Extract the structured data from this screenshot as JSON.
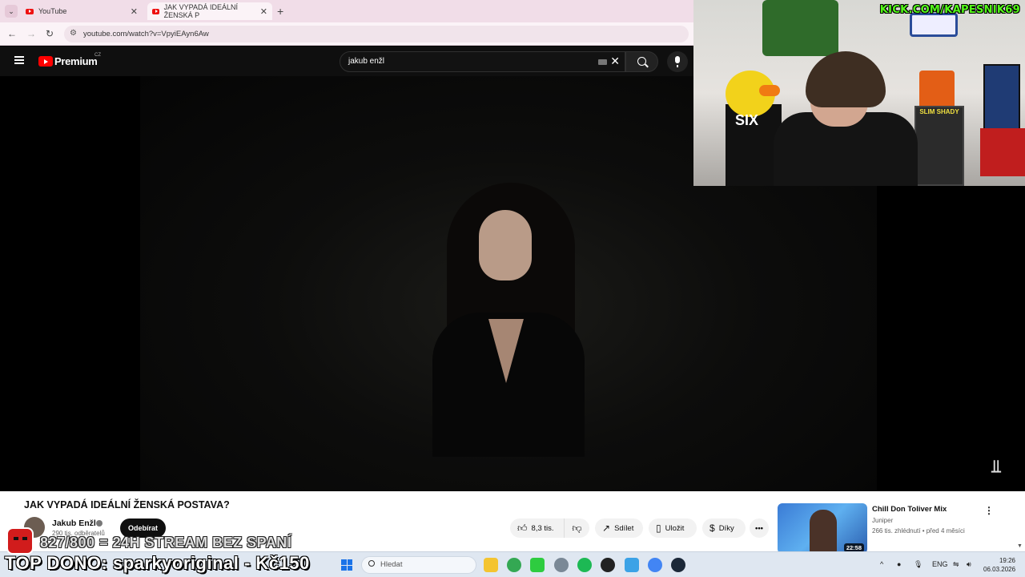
{
  "browser": {
    "tabs": [
      {
        "label": "YouTube",
        "active": false
      },
      {
        "label": "JAK VYPADÁ IDEÁLNÍ ŽENSKÁ P",
        "active": true
      }
    ],
    "url": "youtube.com/watch?v=VpyiEAyn6Aw"
  },
  "youtube": {
    "brand": "Premium",
    "region": "CZ",
    "search_value": "jakub enžl",
    "video": {
      "title": "JAK VYPADÁ IDEÁLNÍ ŽENSKÁ POSTAVA?",
      "channel": "Jakub Enžl",
      "subscribers": "290 tis. odběratelů",
      "subscribe_label": "Odebírat",
      "likes": "8,3 tis.",
      "share_label": "Sdílet",
      "save_label": "Uložit",
      "thanks_label": "Díky",
      "more_label": "•••"
    },
    "recommendation": {
      "title": "Chill Don Toliver Mix",
      "channel": "Juniper",
      "meta": "266 tis. zhlédnutí • před 4 měsíci",
      "duration": "22:58"
    }
  },
  "stream": {
    "kick_label": "KICK.COM/KAPESNIK69",
    "goal": "827/800 = 24H STREAM BEZ SPANÍ",
    "top_donation": "TOP DONO: sparkyoriginal - Kč150",
    "poster_text": "SLIM SHADY",
    "shirt_text": "SIX"
  },
  "taskbar": {
    "search_placeholder": "Hledat",
    "language": "ENG",
    "time": "19:26",
    "date": "06.03.2026"
  },
  "colors": {
    "youtube_red": "#ff0000",
    "kick_green": "#53fc18",
    "yt_dark": "#0f0f0f"
  }
}
